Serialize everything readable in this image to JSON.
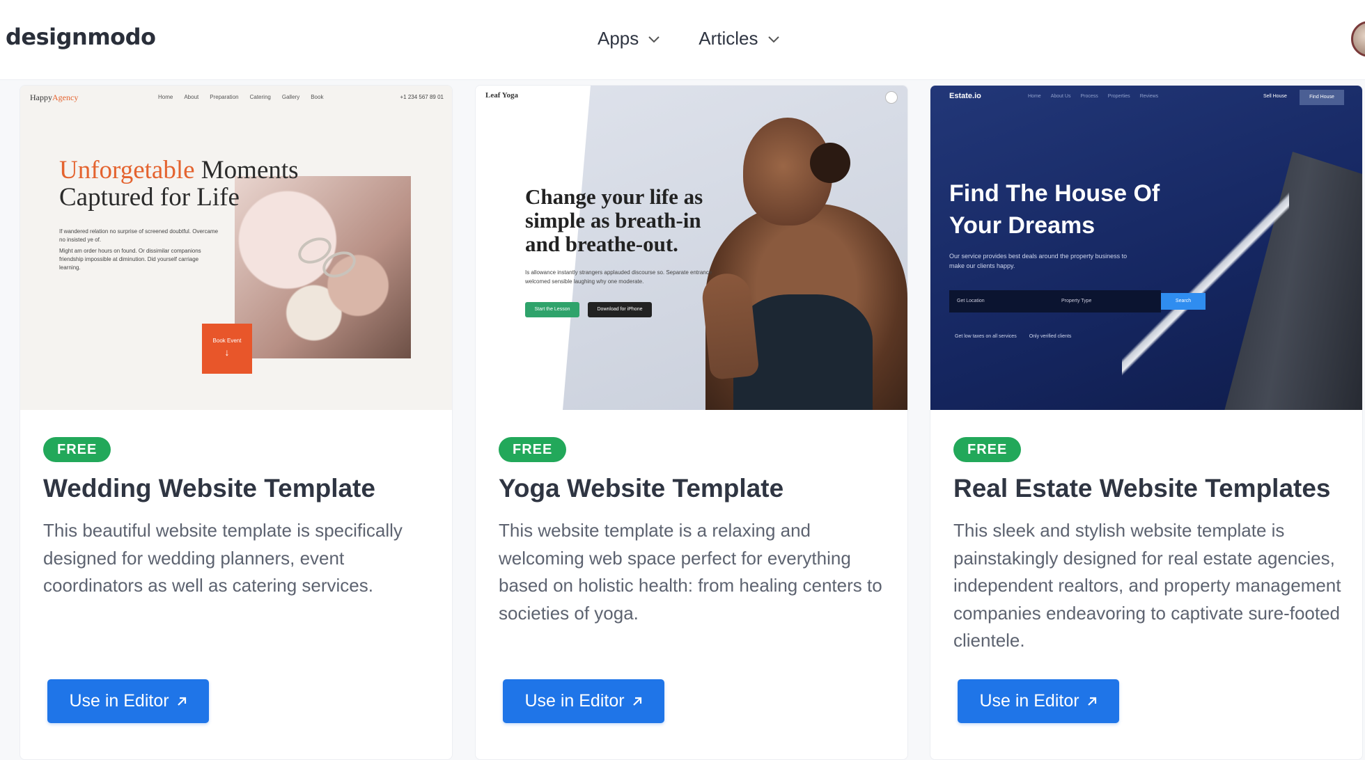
{
  "header": {
    "logo": "designmodo",
    "nav": [
      {
        "label": "Apps"
      },
      {
        "label": "Articles"
      }
    ]
  },
  "colors": {
    "primary_button": "#1f75e8",
    "badge": "#22a85a",
    "title": "#2f3542",
    "text": "#5d6370"
  },
  "cards": [
    {
      "badge": "FREE",
      "title": "Wedding Website Template",
      "description": "This beautiful website template is specifically designed for wedding planners, event coordinators as well as catering services.",
      "button": "Use in Editor",
      "preview": {
        "logo_a": "Happy",
        "logo_b": "Agency",
        "nav": [
          "Home",
          "About",
          "Preparation",
          "Catering",
          "Gallery",
          "Book"
        ],
        "phone": "+1 234 567 89 01",
        "headline_a": "Unforgetable",
        "headline_b": " Moments",
        "headline_c": "Captured for Life",
        "text_1": "If wandered relation no surprise of screened doubtful. Overcame no insisted ye of.",
        "text_2": "Might am order hours on found. Or dissimilar companions friendship impossible at diminution. Did yourself carriage learning.",
        "cta": "Book Event"
      }
    },
    {
      "badge": "FREE",
      "title": "Yoga Website Template",
      "description": "This website template is a relaxing and welcoming web space perfect for everything based on holistic health: from healing centers to societies of yoga.",
      "button": "Use in Editor",
      "preview": {
        "logo": "Leaf Yoga",
        "headline": "Change your life as simple as breath-in and breathe-out.",
        "text": "Is allowance instantly strangers applauded discourse so. Separate entrance welcomed sensible laughing why one moderate.",
        "btn_1": "Start the Lesson",
        "btn_2": "Download for iPhone"
      }
    },
    {
      "badge": "FREE",
      "title": "Real Estate Website Templates",
      "description": "This sleek and stylish website template is painstakingly designed for real estate agencies, independent realtors, and property management companies endeavoring to captivate sure-footed clientele.",
      "button": "Use in Editor",
      "preview": {
        "logo": "Estate.io",
        "nav": [
          "Home",
          "About Us",
          "Process",
          "Properties",
          "Reviews"
        ],
        "sell": "Sell House",
        "find": "Find House",
        "headline": "Find The House Of Your Dreams",
        "text": "Our service provides best deals around the property business to make our clients happy.",
        "field_1": "Get Location",
        "field_2": "Property Type",
        "search": "Search",
        "feature_1": "Get low taxes on all services",
        "feature_2": "Only verified clients"
      }
    }
  ]
}
